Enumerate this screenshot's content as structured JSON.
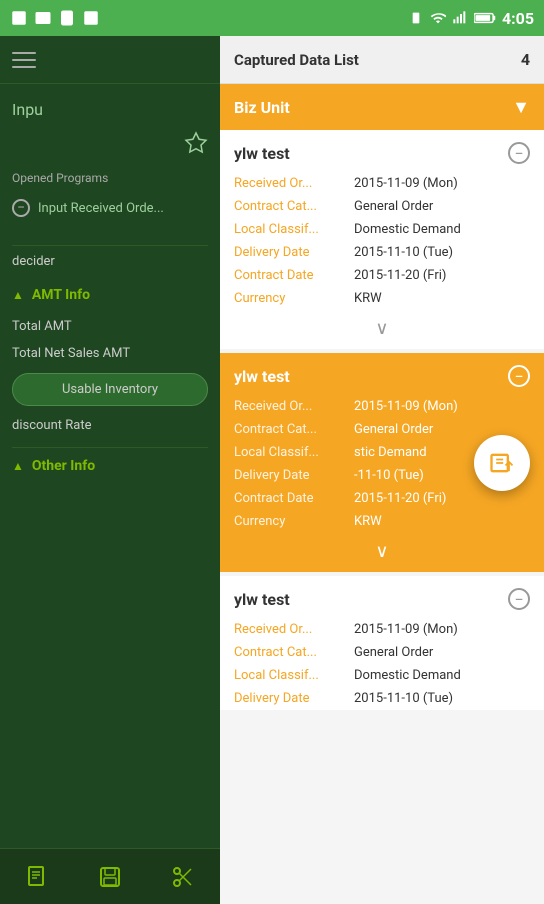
{
  "statusBar": {
    "time": "4:05"
  },
  "leftPanel": {
    "inputLabel": "Inpu",
    "openedProgramsLabel": "Opened Programs",
    "programItem": "Input Received Orde...",
    "deciderLabel": "decider",
    "amtInfoLabel": "AMT Info",
    "totalAmtLabel": "Total AMT",
    "totalNetSalesLabel": "Total Net Sales AMT",
    "usableInventoryLabel": "Usable Inventory",
    "discountRateLabel": "discount Rate",
    "otherInfoLabel": "Other Info",
    "navIcons": [
      "doc-icon",
      "save-icon",
      "settings-icon"
    ]
  },
  "rightPanel": {
    "headerTitle": "Captured Data List",
    "headerCount": "4",
    "bizUnitLabel": "Biz Unit",
    "cards": [
      {
        "id": "card1",
        "title": "ylw test",
        "highlighted": false,
        "rows": [
          {
            "label": "Received Or...",
            "value": "2015-11-09 (Mon)"
          },
          {
            "label": "Contract Cat...",
            "value": "General Order"
          },
          {
            "label": "Local Classif...",
            "value": "Domestic Demand"
          },
          {
            "label": "Delivery Date",
            "value": "2015-11-10 (Tue)"
          },
          {
            "label": "Contract Date",
            "value": "2015-11-20 (Fri)"
          },
          {
            "label": "Currency",
            "value": "KRW"
          }
        ]
      },
      {
        "id": "card2",
        "title": "ylw test",
        "highlighted": true,
        "rows": [
          {
            "label": "Received Or...",
            "value": "2015-11-09 (Mon)"
          },
          {
            "label": "Contract Cat...",
            "value": "General Order"
          },
          {
            "label": "Local Classif...",
            "value": "stic Demand"
          },
          {
            "label": "Delivery Date",
            "value": "-11-10 (Tue)"
          },
          {
            "label": "Contract Date",
            "value": "2015-11-20 (Fri)"
          },
          {
            "label": "Currency",
            "value": "KRW"
          }
        ]
      },
      {
        "id": "card3",
        "title": "ylw test",
        "highlighted": false,
        "rows": [
          {
            "label": "Received Or...",
            "value": "2015-11-09 (Mon)"
          },
          {
            "label": "Contract Cat...",
            "value": "General Order"
          },
          {
            "label": "Local Classif...",
            "value": "Domestic Demand"
          },
          {
            "label": "Delivery Date",
            "value": "2015-11-10 (Tue)"
          }
        ]
      }
    ]
  }
}
